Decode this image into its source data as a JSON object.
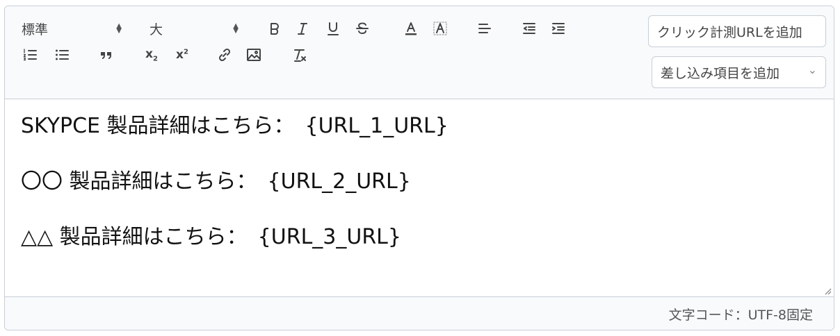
{
  "toolbar": {
    "format_select": "標準",
    "size_select": "大",
    "click_url_button": "クリック計測URLを追加",
    "merge_field_button": "差し込み項目を追加",
    "merge_chevron": "⌄",
    "subscript_label": "x",
    "subscript_mark": "2",
    "superscript_label": "x",
    "superscript_mark": "2"
  },
  "content": {
    "lines": [
      "SKYPCE 製品詳細はこちら：　{URL_1_URL}",
      "〇〇 製品詳細はこちら：　{URL_2_URL}",
      "△△ 製品詳細はこちら：　{URL_3_URL}"
    ]
  },
  "footer": {
    "encoding_note": "文字コード：UTF-8固定"
  }
}
